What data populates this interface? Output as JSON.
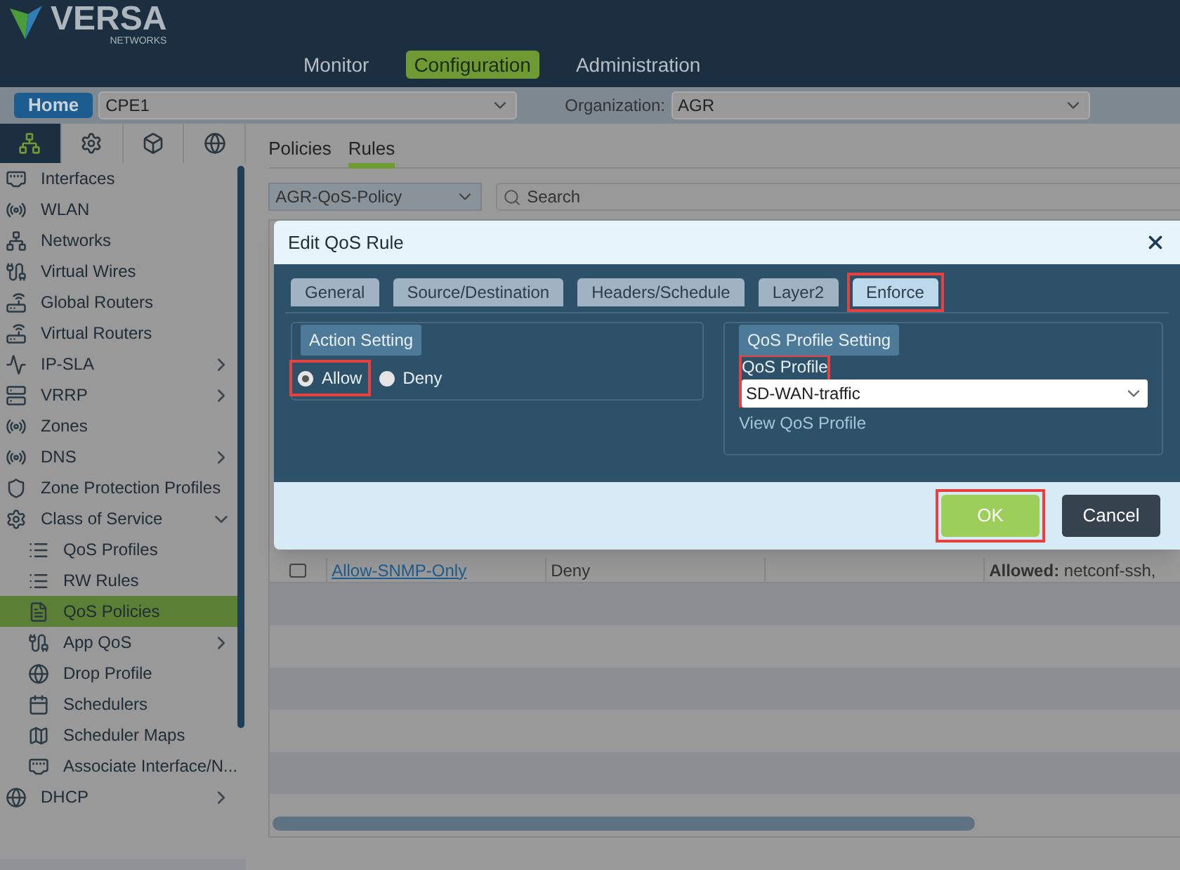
{
  "brand": {
    "name": "VERSA",
    "sub": "NETWORKS"
  },
  "nav": [
    {
      "label": "Monitor",
      "selected": false
    },
    {
      "label": "Configuration",
      "selected": true
    },
    {
      "label": "Administration",
      "selected": false
    }
  ],
  "home": "Home",
  "appliance": "CPE1",
  "org_label": "Organization:",
  "org": "AGR",
  "side_tabs": [
    {
      "kind": "network",
      "selected": true
    },
    {
      "kind": "gear",
      "selected": false
    },
    {
      "kind": "box",
      "selected": false
    },
    {
      "kind": "globe",
      "selected": false
    }
  ],
  "sidebar": [
    {
      "label": "Interfaces",
      "kind": "interface",
      "selected": false
    },
    {
      "label": "WLAN",
      "kind": "antenna",
      "selected": false
    },
    {
      "label": "Networks",
      "kind": "network",
      "selected": false
    },
    {
      "label": "Virtual Wires",
      "kind": "wire",
      "selected": false
    },
    {
      "label": "Global Routers",
      "kind": "router",
      "selected": false
    },
    {
      "label": "Virtual Routers",
      "kind": "router",
      "selected": false
    },
    {
      "label": "IP-SLA",
      "kind": "pulse",
      "selected": false,
      "expanded": false
    },
    {
      "label": "VRRP",
      "kind": "servers",
      "selected": false,
      "expanded": false
    },
    {
      "label": "Zones",
      "kind": "antenna",
      "selected": false
    },
    {
      "label": "DNS",
      "kind": "antenna",
      "selected": false,
      "expanded": false
    },
    {
      "label": "Zone Protection Profiles",
      "kind": "shield",
      "selected": false
    },
    {
      "label": "Class of Service",
      "kind": "gear",
      "selected": false,
      "expanded": true,
      "children": [
        {
          "label": "QoS Profiles",
          "kind": "list",
          "selected": false
        },
        {
          "label": "RW Rules",
          "kind": "list",
          "selected": false
        },
        {
          "label": "QoS Policies",
          "kind": "file",
          "selected": true
        },
        {
          "label": "App QoS",
          "kind": "wire",
          "selected": false,
          "expanded": false
        },
        {
          "label": "Drop Profile",
          "kind": "globe",
          "selected": false
        },
        {
          "label": "Schedulers",
          "kind": "calendar",
          "selected": false
        },
        {
          "label": "Scheduler Maps",
          "kind": "map",
          "selected": false
        },
        {
          "label": "Associate Interface/N...",
          "kind": "interface",
          "selected": false
        }
      ]
    },
    {
      "label": "DHCP",
      "kind": "globe",
      "selected": false,
      "expanded": false
    }
  ],
  "page_tabs": [
    {
      "label": "Policies",
      "selected": false
    },
    {
      "label": "Rules",
      "selected": true
    }
  ],
  "policy": "AGR-QoS-Policy",
  "search": {
    "placeholder": "Search"
  },
  "table_row": {
    "checked": false,
    "cells": [
      "Allow-SNMP-Only",
      "Deny",
      "",
      "**Allowed:** netconf-ssh,"
    ]
  },
  "dialog": {
    "title": "Edit QoS Rule",
    "tabs": [
      {
        "label": "General",
        "selected": false,
        "highlighted": false
      },
      {
        "label": "Source/Destination",
        "selected": false,
        "highlighted": false
      },
      {
        "label": "Headers/Schedule",
        "selected": false,
        "highlighted": false
      },
      {
        "label": "Layer2",
        "selected": false,
        "highlighted": false
      },
      {
        "label": "Enforce",
        "selected": true,
        "highlighted": true
      }
    ],
    "action_setting": {
      "title": "Action Setting",
      "options": [
        {
          "label": "Allow",
          "selected": true,
          "highlighted": true
        },
        {
          "label": "Deny",
          "selected": false,
          "highlighted": false
        }
      ]
    },
    "qos_setting": {
      "title": "QoS Profile Setting",
      "field_label": "QoS Profile",
      "value": "SD-WAN-traffic",
      "highlighted": true,
      "link": "View QoS Profile"
    },
    "buttons": [
      {
        "label": "OK",
        "kind": "primary",
        "highlighted": true
      },
      {
        "label": "Cancel",
        "kind": "secondary",
        "highlighted": false
      }
    ]
  }
}
